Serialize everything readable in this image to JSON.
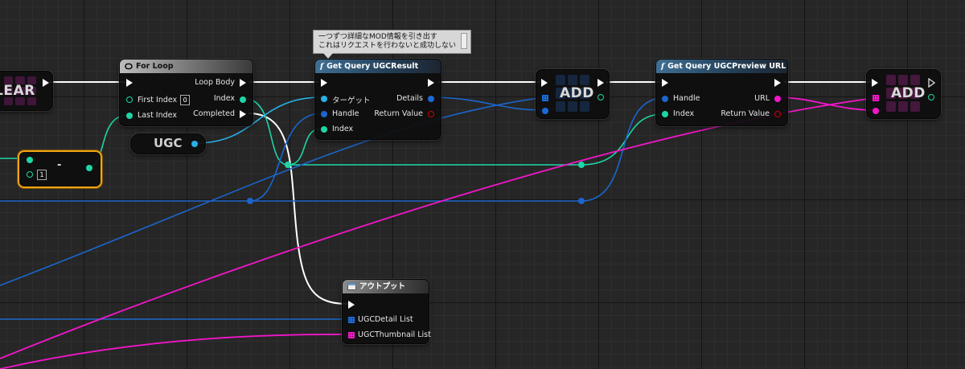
{
  "colors": {
    "exec": "#ffffff",
    "int": "#1ed6a5",
    "struct": "#1b6ad8",
    "string": "#f116c8",
    "bool": "#cc0000",
    "handle_struct": "#1b66cc"
  },
  "nodes": {
    "clear": {
      "label": "LEAR"
    },
    "for_loop": {
      "title": "For Loop",
      "title_icon": "loop-icon",
      "pins_in": {
        "exec": "",
        "first_index": "First Index",
        "first_index_value": "0",
        "last_index": "Last Index"
      },
      "pins_out": {
        "loop_body": "Loop Body",
        "index": "Index",
        "completed": "Completed"
      }
    },
    "subtract": {
      "op": "-",
      "literal": "1"
    },
    "ugc_var": {
      "label": "UGC"
    },
    "get_query_ugc_result": {
      "title": "Get Query UGCResult",
      "title_icon": "function-icon",
      "pins_in": {
        "target": "ターゲット",
        "handle": "Handle",
        "index": "Index"
      },
      "pins_out": {
        "details": "Details",
        "return_value": "Return Value"
      }
    },
    "comment": {
      "line1": "一つずつ詳細なMOD情報を引き出す",
      "line2": "これはリクエストを行わないと成功しない"
    },
    "add1": {
      "label": "ADD"
    },
    "get_query_preview_url": {
      "title": "Get Query UGCPreview URL",
      "title_icon": "function-icon",
      "pins_in": {
        "handle": "Handle",
        "index": "Index"
      },
      "pins_out": {
        "url": "URL",
        "return_value": "Return Value"
      }
    },
    "add2": {
      "label": "ADD"
    },
    "output": {
      "title": "アウトプット",
      "title_icon": "output-icon",
      "pins_in": {
        "detail_list": "UGCDetail List",
        "thumb_list": "UGCThumbnail List"
      }
    }
  }
}
